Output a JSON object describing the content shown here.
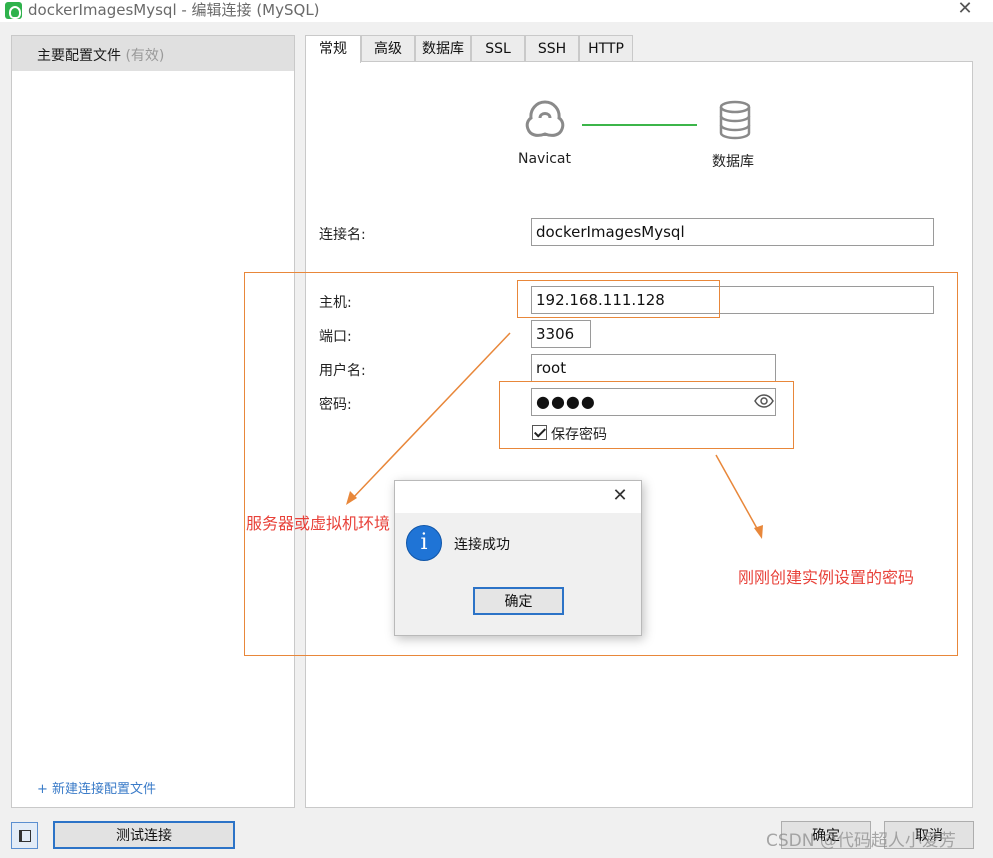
{
  "window": {
    "title": "dockerImagesMysql - 编辑连接 (MySQL)",
    "close_icon": "close-icon"
  },
  "sidebar": {
    "profile_label": "主要配置文件",
    "profile_status": "(有效)",
    "new_profile_link": "+ 新建连接配置文件"
  },
  "tabs": [
    {
      "label": "常规",
      "active": true
    },
    {
      "label": "高级",
      "active": false
    },
    {
      "label": "数据库",
      "active": false
    },
    {
      "label": "SSL",
      "active": false
    },
    {
      "label": "SSH",
      "active": false
    },
    {
      "label": "HTTP",
      "active": false
    }
  ],
  "diagram": {
    "left_label": "Navicat",
    "right_label": "数据库",
    "line_color": "#3cb54a",
    "left_icon": "navicat-icon",
    "right_icon": "database-icon"
  },
  "form": {
    "conn_name_label": "连接名:",
    "conn_name_value": "dockerImagesMysql",
    "host_label": "主机:",
    "host_value": "192.168.111.128",
    "port_label": "端口:",
    "port_value": "3306",
    "user_label": "用户名:",
    "user_value": "root",
    "password_label": "密码:",
    "password_value": "●●●●",
    "save_password_label": "保存密码",
    "save_password_checked": true
  },
  "annotations": {
    "host_note": "服务器或虚拟机环境",
    "password_note": "刚刚创建实例设置的密码",
    "color": "#e8873a"
  },
  "dialog": {
    "message": "连接成功",
    "ok_label": "确定",
    "icon": "info-icon"
  },
  "footer": {
    "test_button": "测试连接",
    "ok_button": "确定",
    "cancel_button": "取消",
    "watermark": "CSDN @代码超人小爱芳"
  }
}
